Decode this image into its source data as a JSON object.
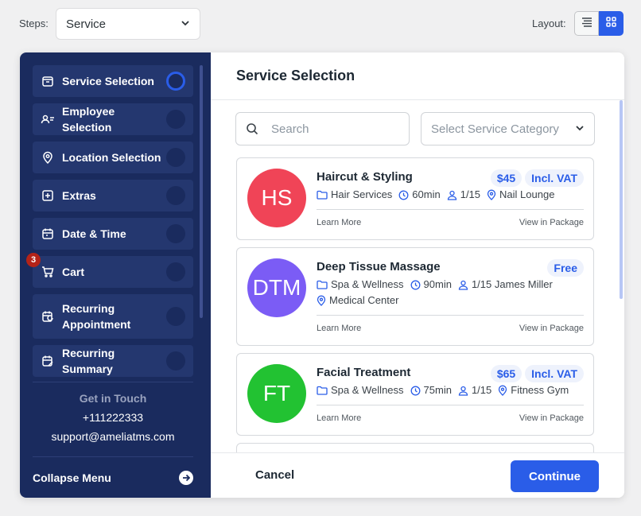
{
  "topbar": {
    "steps_label": "Steps:",
    "steps_value": "Service",
    "layout_label": "Layout:"
  },
  "sidebar": {
    "steps": [
      {
        "label": "Service Selection",
        "icon": "service-icon",
        "active": true
      },
      {
        "label": "Employee Selection",
        "icon": "employee-icon"
      },
      {
        "label": "Location Selection",
        "icon": "location-icon"
      },
      {
        "label": "Extras",
        "icon": "plus-square-icon"
      },
      {
        "label": "Date & Time",
        "icon": "calendar-icon"
      },
      {
        "label": "Cart",
        "icon": "cart-icon",
        "badge": "3"
      },
      {
        "label": "Recurring Appointment",
        "icon": "recurring-calendar-icon"
      },
      {
        "label": "Recurring Summary",
        "icon": "calendar-edit-icon"
      }
    ],
    "contact": {
      "title": "Get in Touch",
      "phone": "+111222333",
      "email": "support@ameliatms.com"
    },
    "collapse_label": "Collapse Menu"
  },
  "main": {
    "title": "Service Selection",
    "search_placeholder": "Search",
    "category_placeholder": "Select Service Category",
    "services": [
      {
        "initials": "HS",
        "name": "Haircut & Styling",
        "price": "$45",
        "vat": "Incl. VAT",
        "category": "Hair Services",
        "duration": "60min",
        "capacity": "1/15",
        "employee": "",
        "location": "Nail Lounge",
        "learn_more": "Learn More",
        "package": "View in Package",
        "color": "#f04457"
      },
      {
        "initials": "DTM",
        "name": "Deep Tissue Massage",
        "price": "Free",
        "vat": "",
        "category": "Spa & Wellness",
        "duration": "90min",
        "capacity": "1/15",
        "employee": "James Miller",
        "location": "Medical Center",
        "learn_more": "Learn More",
        "package": "View in Package",
        "color": "#7b5cf5"
      },
      {
        "initials": "FT",
        "name": "Facial Treatment",
        "price": "$65",
        "vat": "Incl. VAT",
        "category": "Spa & Wellness",
        "duration": "75min",
        "capacity": "1/15",
        "employee": "",
        "location": "Fitness Gym",
        "learn_more": "Learn More",
        "package": "View in Package",
        "color": "#22c232"
      }
    ],
    "cancel_label": "Cancel",
    "continue_label": "Continue"
  },
  "colors": {
    "sidebar_bg": "#1a2b5e",
    "step_bg": "#24376f",
    "accent": "#2a5de8",
    "badge": "#b42318"
  }
}
